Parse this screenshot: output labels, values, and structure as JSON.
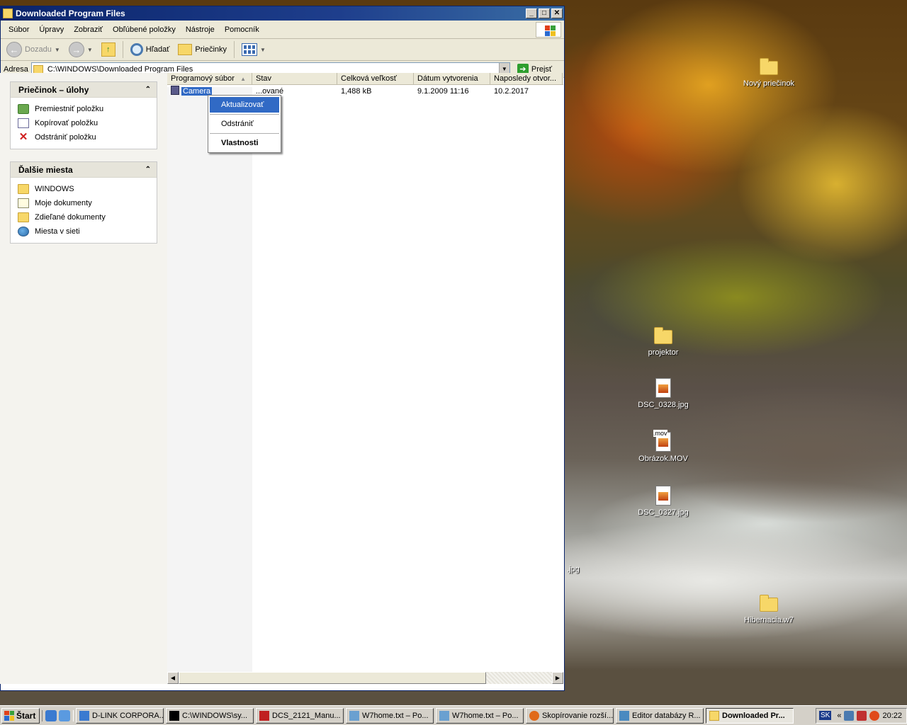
{
  "window": {
    "title": "Downloaded Program Files",
    "title_buttons": {
      "minimize": "_",
      "maximize": "□",
      "close": "✕"
    }
  },
  "menubar": [
    "Súbor",
    "Úpravy",
    "Zobraziť",
    "Obľúbené položky",
    "Nástroje",
    "Pomocník"
  ],
  "toolbar": {
    "back": "Dozadu",
    "search": "Hľadať",
    "folders": "Priečinky"
  },
  "address": {
    "label": "Adresa",
    "value": "C:\\WINDOWS\\Downloaded Program Files",
    "go": "Prejsť"
  },
  "tasks_panel": {
    "title": "Priečinok – úlohy",
    "items": [
      "Premiestniť položku",
      "Kopírovať položku",
      "Odstrániť položku"
    ]
  },
  "places_panel": {
    "title": "Ďalšie miesta",
    "items": [
      "WINDOWS",
      "Moje dokumenty",
      "Zdieľané dokumenty",
      "Miesta v sieti"
    ]
  },
  "columns": [
    "Programový súbor",
    "Stav",
    "Celková veľkosť",
    "Dátum vytvorenia",
    "Naposledy otvor..."
  ],
  "rows": [
    {
      "name": "Camera",
      "status": "...ované",
      "size": "1,488 kB",
      "created": "9.1.2009 11:16",
      "opened": "10.2.2017"
    }
  ],
  "context_menu": [
    "Aktualizovať",
    "Odstrániť",
    "Vlastnosti"
  ],
  "desktop_icons": [
    {
      "label": "Nový priečinok",
      "type": "folder"
    },
    {
      "label": "projektor",
      "type": "folder"
    },
    {
      "label": "DSC_0328.jpg",
      "type": "image"
    },
    {
      "label": "Obrázok.MOV",
      "type": "video",
      "badge": ".mov"
    },
    {
      "label": "DSC_0327.jpg",
      "type": "image"
    },
    {
      "label": ".jpg",
      "type": "partial"
    },
    {
      "label": "Hibernacia.w7",
      "type": "folder"
    }
  ],
  "taskbar": {
    "start": "Štart",
    "tasks": [
      "D-LINK CORPORA...",
      "C:\\WINDOWS\\sy...",
      "DCS_2121_Manu...",
      "W7home.txt – Po...",
      "W7home.txt – Po...",
      "Skopírovanie rozší...",
      "Editor databázy R...",
      "Downloaded Pr..."
    ],
    "lang": "SK",
    "tray_chevron": "«",
    "clock": "20:22"
  }
}
